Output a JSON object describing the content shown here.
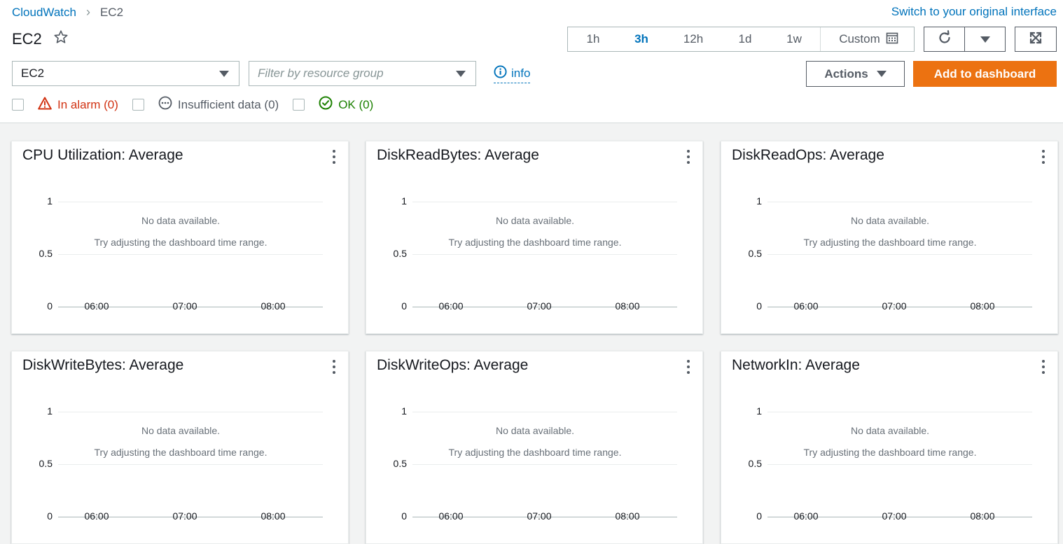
{
  "breadcrumb": {
    "root": "CloudWatch",
    "separator": "›",
    "current": "EC2"
  },
  "switch_link": "Switch to your original interface",
  "page_title": "EC2",
  "time_range": {
    "options": [
      "1h",
      "3h",
      "12h",
      "1d",
      "1w"
    ],
    "active": "3h",
    "custom_label": "Custom"
  },
  "service_select": {
    "value": "EC2"
  },
  "resource_filter": {
    "placeholder": "Filter by resource group"
  },
  "info_label": "info",
  "actions_label": "Actions",
  "add_dashboard_label": "Add to dashboard",
  "filters": {
    "in_alarm": "In alarm (0)",
    "insufficient": "Insufficient data (0)",
    "ok": "OK (0)"
  },
  "colors": {
    "accent": "#0073bb",
    "primary_button": "#ec7211",
    "alarm": "#d13212",
    "ok": "#1d8102"
  },
  "widgets": [
    {
      "title": "CPU Utilization: Average"
    },
    {
      "title": "DiskReadBytes: Average"
    },
    {
      "title": "DiskReadOps: Average"
    },
    {
      "title": "DiskWriteBytes: Average"
    },
    {
      "title": "DiskWriteOps: Average"
    },
    {
      "title": "NetworkIn: Average"
    }
  ],
  "chart_data": [
    {
      "type": "line",
      "title": "CPU Utilization: Average",
      "x_ticks": [
        "06:00",
        "07:00",
        "08:00"
      ],
      "y_ticks": [
        "1",
        "0.5",
        "0"
      ],
      "ylim": [
        0,
        1
      ],
      "series": [],
      "annotations": [
        "No data available.",
        "Try adjusting the dashboard time range."
      ]
    },
    {
      "type": "line",
      "title": "DiskReadBytes: Average",
      "x_ticks": [
        "06:00",
        "07:00",
        "08:00"
      ],
      "y_ticks": [
        "1",
        "0.5",
        "0"
      ],
      "ylim": [
        0,
        1
      ],
      "series": [],
      "annotations": [
        "No data available.",
        "Try adjusting the dashboard time range."
      ]
    },
    {
      "type": "line",
      "title": "DiskReadOps: Average",
      "x_ticks": [
        "06:00",
        "07:00",
        "08:00"
      ],
      "y_ticks": [
        "1",
        "0.5",
        "0"
      ],
      "ylim": [
        0,
        1
      ],
      "series": [],
      "annotations": [
        "No data available.",
        "Try adjusting the dashboard time range."
      ]
    },
    {
      "type": "line",
      "title": "DiskWriteBytes: Average",
      "x_ticks": [
        "06:00",
        "07:00",
        "08:00"
      ],
      "y_ticks": [
        "1",
        "0.5",
        "0"
      ],
      "ylim": [
        0,
        1
      ],
      "series": [],
      "annotations": [
        "No data available.",
        "Try adjusting the dashboard time range."
      ]
    },
    {
      "type": "line",
      "title": "DiskWriteOps: Average",
      "x_ticks": [
        "06:00",
        "07:00",
        "08:00"
      ],
      "y_ticks": [
        "1",
        "0.5",
        "0"
      ],
      "ylim": [
        0,
        1
      ],
      "series": [],
      "annotations": [
        "No data available.",
        "Try adjusting the dashboard time range."
      ]
    },
    {
      "type": "line",
      "title": "NetworkIn: Average",
      "x_ticks": [
        "06:00",
        "07:00",
        "08:00"
      ],
      "y_ticks": [
        "1",
        "0.5",
        "0"
      ],
      "ylim": [
        0,
        1
      ],
      "series": [],
      "annotations": [
        "No data available.",
        "Try adjusting the dashboard time range."
      ]
    }
  ]
}
